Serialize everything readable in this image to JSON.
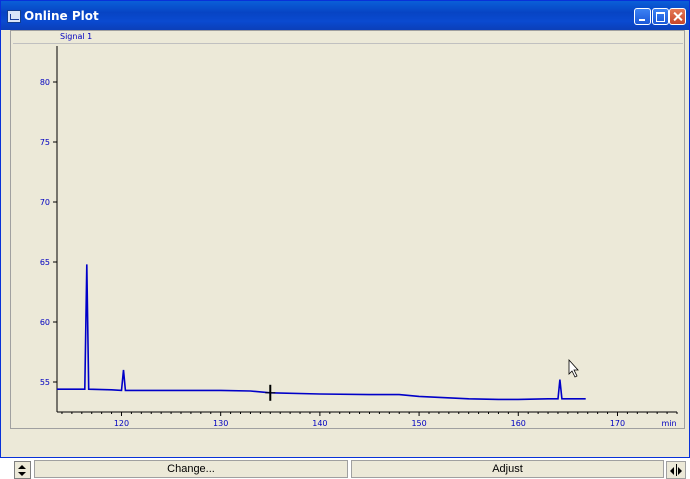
{
  "window": {
    "title": "Online Plot",
    "title_icon": "plot-window-icon",
    "controls": [
      "minimize-icon",
      "maximize-icon",
      "close-icon"
    ]
  },
  "legend": {
    "signal": "Signal 1"
  },
  "buttons": {
    "change": "Change...",
    "adjust": "Adjust",
    "spin": "up-down-arrows-icon",
    "pan": "left-right-arrows-icon"
  },
  "colors": {
    "trace": "#0000c8",
    "axis_text": "#0000c0",
    "window_bg": "#ece9d8",
    "titlebar": "#0a4ad0"
  },
  "chart_data": {
    "type": "line",
    "series": [
      {
        "x": [
          113.5,
          116,
          116.3,
          116.5,
          116.7,
          119,
          120,
          120.2,
          120.4,
          125,
          130,
          133,
          135,
          140,
          145,
          148,
          150,
          155,
          158,
          160,
          163,
          164,
          164.2,
          164.4,
          165,
          166.8
        ],
        "y": [
          54.4,
          54.4,
          54.4,
          64.8,
          54.4,
          54.35,
          54.3,
          56.0,
          54.3,
          54.3,
          54.3,
          54.25,
          54.1,
          54.0,
          53.95,
          53.95,
          53.8,
          53.6,
          53.55,
          53.55,
          53.6,
          53.6,
          55.2,
          53.6,
          53.6,
          53.6
        ]
      }
    ],
    "xlim": [
      113.5,
      176
    ],
    "ylim": [
      52.5,
      83
    ],
    "xticks": [
      120,
      130,
      140,
      150,
      160,
      170
    ],
    "yticks": [
      55,
      60,
      65,
      70,
      75,
      80
    ],
    "xunit": "min",
    "grid": false
  }
}
